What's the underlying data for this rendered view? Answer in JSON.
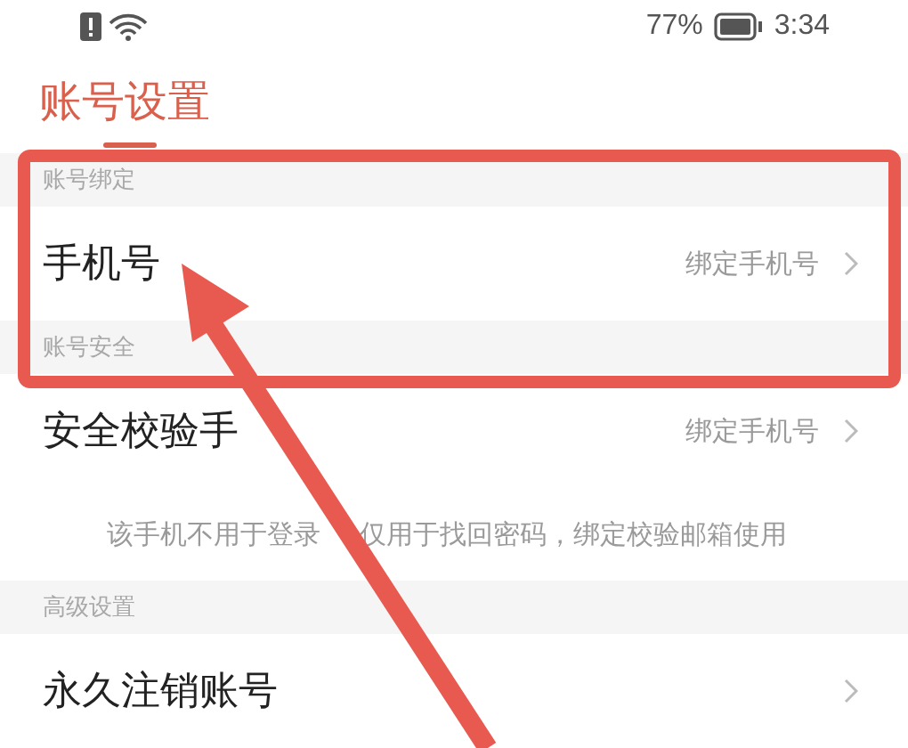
{
  "status_bar": {
    "battery": "77%",
    "time": "3:34"
  },
  "title": "账号设置",
  "sections": [
    {
      "header": "账号绑定",
      "rows": [
        {
          "kind": "link",
          "label": "手机号",
          "value": "绑定手机号"
        }
      ]
    },
    {
      "header": "账号安全",
      "rows": [
        {
          "kind": "link",
          "label": "安全校验手",
          "value": "绑定手机号"
        },
        {
          "kind": "note",
          "texts": [
            "该手机不用于登录",
            "仅用于找回密码，绑定校验邮箱使用"
          ]
        }
      ]
    },
    {
      "header": "高级设置",
      "rows": [
        {
          "kind": "link",
          "label": "永久注销账号"
        }
      ]
    }
  ]
}
